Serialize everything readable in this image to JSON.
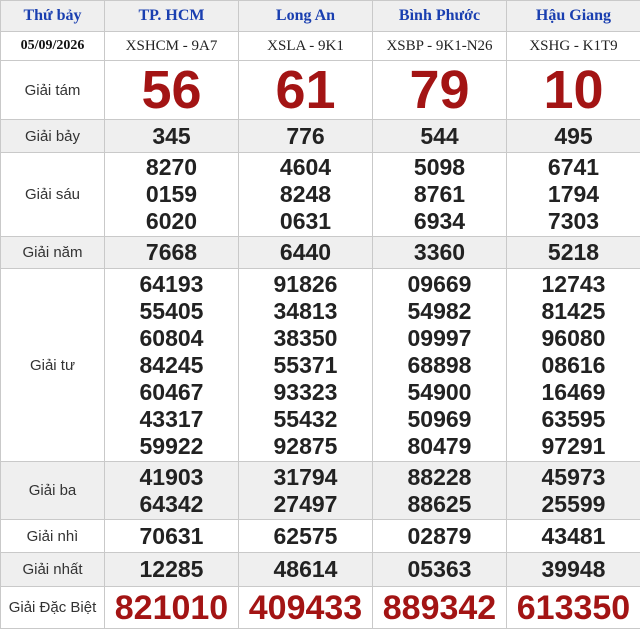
{
  "header": {
    "day": "Thứ bảy",
    "date": "05/09/2026",
    "provinces": [
      "TP. HCM",
      "Long An",
      "Bình Phước",
      "Hậu Giang"
    ],
    "codes": [
      "XSHCM - 9A7",
      "XSLA - 9K1",
      "XSBP - 9K1-N26",
      "XSHG - K1T9"
    ]
  },
  "prizes": {
    "g8": {
      "label": "Giải tám",
      "values": [
        "56",
        "61",
        "79",
        "10"
      ]
    },
    "g7": {
      "label": "Giải bảy",
      "values": [
        "345",
        "776",
        "544",
        "495"
      ]
    },
    "g6": {
      "label": "Giải sáu",
      "values": [
        [
          "8270",
          "0159",
          "6020"
        ],
        [
          "4604",
          "8248",
          "0631"
        ],
        [
          "5098",
          "8761",
          "6934"
        ],
        [
          "6741",
          "1794",
          "7303"
        ]
      ]
    },
    "g5": {
      "label": "Giải năm",
      "values": [
        "7668",
        "6440",
        "3360",
        "5218"
      ]
    },
    "g4": {
      "label": "Giải tư",
      "values": [
        [
          "64193",
          "55405",
          "60804",
          "84245",
          "60467",
          "43317",
          "59922"
        ],
        [
          "91826",
          "34813",
          "38350",
          "55371",
          "93323",
          "55432",
          "92875"
        ],
        [
          "09669",
          "54982",
          "09997",
          "68898",
          "54900",
          "50969",
          "80479"
        ],
        [
          "12743",
          "81425",
          "96080",
          "08616",
          "16469",
          "63595",
          "97291"
        ]
      ]
    },
    "g3": {
      "label": "Giải ba",
      "values": [
        [
          "41903",
          "64342"
        ],
        [
          "31794",
          "27497"
        ],
        [
          "88228",
          "88625"
        ],
        [
          "45973",
          "25599"
        ]
      ]
    },
    "g2": {
      "label": "Giải nhì",
      "values": [
        "70631",
        "62575",
        "02879",
        "43481"
      ]
    },
    "g1": {
      "label": "Giải nhất",
      "values": [
        "12285",
        "48614",
        "05363",
        "39948"
      ]
    },
    "db": {
      "label": "Giải Đặc Biệt",
      "values": [
        "821010",
        "409433",
        "889342",
        "613350"
      ]
    }
  }
}
